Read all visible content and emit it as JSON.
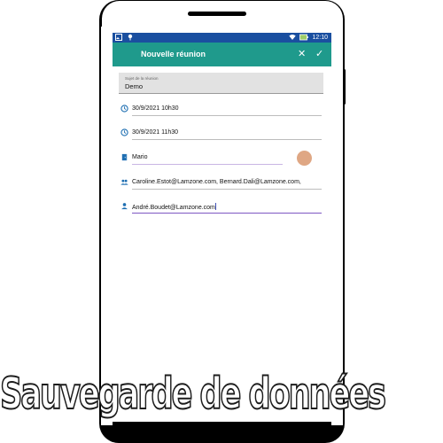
{
  "status_bar": {
    "time": "12:10",
    "left_icons": [
      "gallery-icon",
      "location-icon"
    ],
    "right_icons": [
      "wifi-icon",
      "battery-icon"
    ]
  },
  "app_bar": {
    "title": "Nouvelle réunion",
    "close_label": "✕",
    "confirm_label": "✓",
    "color": "#1f9a8c"
  },
  "form": {
    "subject": {
      "label": "Sujet de la réunion",
      "value": "Demo"
    },
    "start_time": {
      "icon": "clock-icon",
      "value": "30/9/2021 10h30"
    },
    "end_time": {
      "icon": "clock-icon",
      "value": "30/9/2021 11h30"
    },
    "room": {
      "icon": "door-icon",
      "value": "Mario",
      "room_color": "#dfa784"
    },
    "participants": {
      "icon": "group-icon",
      "value": "Caroline.Estot@Lamzone.com, Bernard.Dali@Lamzone.com,"
    },
    "new_participant": {
      "icon": "person-icon",
      "value": "André.Boudet@Lamzone.com"
    }
  },
  "watermark": {
    "text": "Sauvegarde de données"
  }
}
